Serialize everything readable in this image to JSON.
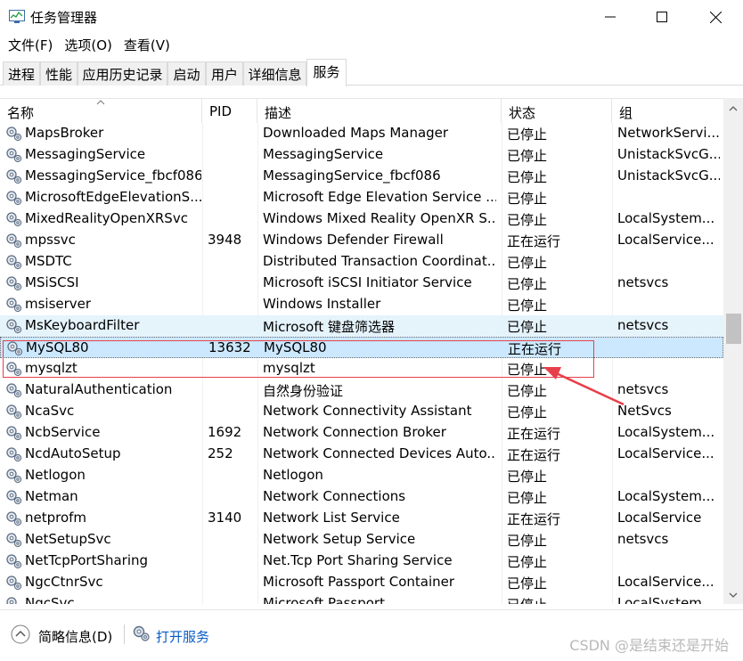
{
  "window": {
    "title": "任务管理器"
  },
  "menu": [
    "文件(F)",
    "选项(O)",
    "查看(V)"
  ],
  "tabs": [
    "进程",
    "性能",
    "应用历史记录",
    "启动",
    "用户",
    "详细信息",
    "服务"
  ],
  "active_tab": "服务",
  "columns": {
    "name": "名称",
    "pid": "PID",
    "desc": "描述",
    "status": "状态",
    "group": "组"
  },
  "rows": [
    {
      "name": "MapsBroker",
      "pid": "",
      "desc": "Downloaded Maps Manager",
      "status": "已停止",
      "group": "NetworkServi..."
    },
    {
      "name": "MessagingService",
      "pid": "",
      "desc": "MessagingService",
      "status": "已停止",
      "group": "UnistackSvcG..."
    },
    {
      "name": "MessagingService_fbcf086",
      "pid": "",
      "desc": "MessagingService_fbcf086",
      "status": "已停止",
      "group": "UnistackSvcG..."
    },
    {
      "name": "MicrosoftEdgeElevationS...",
      "pid": "",
      "desc": "Microsoft Edge Elevation Service ...",
      "status": "已停止",
      "group": ""
    },
    {
      "name": "MixedRealityOpenXRSvc",
      "pid": "",
      "desc": "Windows Mixed Reality OpenXR S...",
      "status": "已停止",
      "group": "LocalSystem..."
    },
    {
      "name": "mpssvc",
      "pid": "3948",
      "desc": "Windows Defender Firewall",
      "status": "正在运行",
      "group": "LocalService..."
    },
    {
      "name": "MSDTC",
      "pid": "",
      "desc": "Distributed Transaction Coordinat...",
      "status": "已停止",
      "group": ""
    },
    {
      "name": "MSiSCSI",
      "pid": "",
      "desc": "Microsoft iSCSI Initiator Service",
      "status": "已停止",
      "group": "netsvcs"
    },
    {
      "name": "msiserver",
      "pid": "",
      "desc": "Windows Installer",
      "status": "已停止",
      "group": ""
    },
    {
      "name": "MsKeyboardFilter",
      "pid": "",
      "desc": "Microsoft 键盘筛选器",
      "status": "已停止",
      "group": "netsvcs"
    },
    {
      "name": "MySQL80",
      "pid": "13632",
      "desc": "MySQL80",
      "status": "正在运行",
      "group": ""
    },
    {
      "name": "mysqlzt",
      "pid": "",
      "desc": "mysqlzt",
      "status": "已停止",
      "group": ""
    },
    {
      "name": "NaturalAuthentication",
      "pid": "",
      "desc": "自然身份验证",
      "status": "已停止",
      "group": "netsvcs"
    },
    {
      "name": "NcaSvc",
      "pid": "",
      "desc": "Network Connectivity Assistant",
      "status": "已停止",
      "group": "NetSvcs"
    },
    {
      "name": "NcbService",
      "pid": "1692",
      "desc": "Network Connection Broker",
      "status": "正在运行",
      "group": "LocalSystem..."
    },
    {
      "name": "NcdAutoSetup",
      "pid": "252",
      "desc": "Network Connected Devices Auto...",
      "status": "正在运行",
      "group": "LocalService..."
    },
    {
      "name": "Netlogon",
      "pid": "",
      "desc": "Netlogon",
      "status": "已停止",
      "group": ""
    },
    {
      "name": "Netman",
      "pid": "",
      "desc": "Network Connections",
      "status": "已停止",
      "group": "LocalSystem..."
    },
    {
      "name": "netprofm",
      "pid": "3140",
      "desc": "Network List Service",
      "status": "正在运行",
      "group": "LocalService"
    },
    {
      "name": "NetSetupSvc",
      "pid": "",
      "desc": "Network Setup Service",
      "status": "已停止",
      "group": "netsvcs"
    },
    {
      "name": "NetTcpPortSharing",
      "pid": "",
      "desc": "Net.Tcp Port Sharing Service",
      "status": "已停止",
      "group": ""
    },
    {
      "name": "NgcCtnrSvc",
      "pid": "",
      "desc": "Microsoft Passport Container",
      "status": "已停止",
      "group": "LocalService..."
    },
    {
      "name": "NgcSvc",
      "pid": "",
      "desc": "Microsoft Passport",
      "status": "已停止",
      "group": "LocalSystem..."
    }
  ],
  "hover_row": 9,
  "selected_row": 10,
  "footer": {
    "collapse_label": "简略信息(D)",
    "open_services": "打开服务",
    "watermark": "CSDN @是结束还是开始"
  },
  "colors": {
    "hover": "#e5f3fb",
    "selected": "#cce8ff",
    "annotation": "#e8404a",
    "link": "#0a5cc6"
  }
}
